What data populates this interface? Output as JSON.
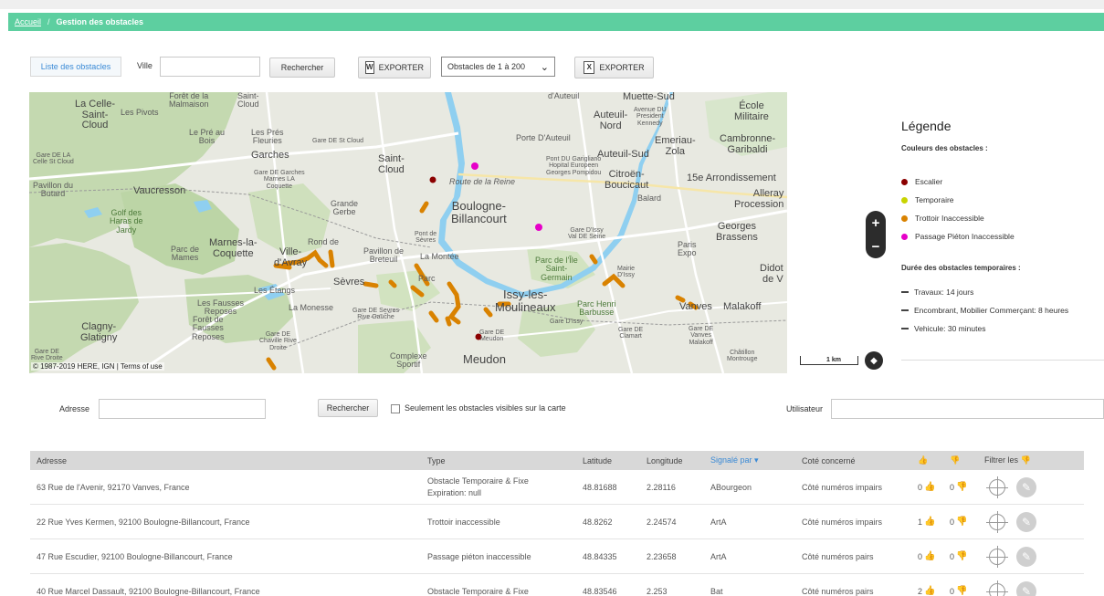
{
  "breadcrumb": {
    "home": "Accueil",
    "separator": "/",
    "current": "Gestion des obstacles"
  },
  "toolbar": {
    "list_tab": "Liste des obstacles",
    "ville_label": "Ville",
    "ville_value": "",
    "search_button": "Rechercher",
    "export_word": "EXPORTER",
    "export_excel": "EXPORTER",
    "range_select": "Obstacles de 1 à 200",
    "word_icon": "W",
    "excel_icon": "X"
  },
  "map": {
    "labels": {
      "la_celle": "La Celle-\nSaint-\nCloud",
      "pivots": "Les Pivots",
      "foret_malmaison": "Forêt de la\nMalmaison",
      "saint_cloud_small": "Saint-\nCloud",
      "pre_au_bois": "Le Pré au\nBois",
      "pres_fleuries": "Les Prés\nFleuries",
      "garches": "Garches",
      "gare_lacelle": "Gare DE LA\nCelle St Cloud",
      "gare_st_cloud": "Gare DE St Cloud",
      "saint_cloud": "Saint-\nCloud",
      "gare_garches": "Gare DE Garches\nMarnes LA\nCoquette",
      "pavillon_butard": "Pavillon du\nButard",
      "vaucresson": "Vaucresson",
      "grande_gerbe": "Grande\nGerbe",
      "golf": "Golf des\nHaras de\nJardy",
      "marnes": "Marnes-la-\nCoquette",
      "parc_mames": "Parc de\nMames",
      "ville_avray": "Ville-\nd'Avray",
      "rond": "Rond de",
      "pavillon_breteuil": "Pavillon de\nBreteuil",
      "sevres": "Sèvres",
      "etangs": "Les Étangs",
      "fausses_reposes": "Les Fausses\nReposes",
      "monesse": "La Monesse",
      "foret_fausses": "Forêt de\nFausses\nReposes",
      "clagny": "Clagny-\nGlatigny",
      "gare_chaville": "Gare DE\nChaville Rive\nDroite",
      "gare_sevres_rg": "Gare DE Sevres\nRive Gauche",
      "gare_rive": "Gare DE\nRive Droite",
      "complexe": "Complexe\nSportif",
      "meudon": "Meudon",
      "gare_meudon": "Gare DE\nMeudon",
      "auteuil_top": "d'Auteuil",
      "auteuil_nord": "Auteuil-\nNord",
      "porte_auteuil": "Porte D'Auteuil",
      "auteuil_sud": "Auteuil-Sud",
      "route_reine": "Route de la Reine",
      "boulogne": "Boulogne-\nBillancourt",
      "pont_sevres": "Pont de\nSèvres",
      "la_montee": "La Montée",
      "parc_sevres": "Parc",
      "pont_garigliano": "Pont DU Garigliano\nHopital Europeen\nGeorges Pompidou",
      "muette_sud": "Muette-Sud",
      "president_kennedy": "Avenue DU\nPresident\nKennedy",
      "emeriau": "Emeriau-\nZola",
      "citroen": "Citroën-\nBoucicaut",
      "balard": "Balard",
      "gare_issy": "Gare D'Issy\nVal DE Seine",
      "parc_ile": "Parc de l'Île\nSaint-\nGermain",
      "mairie_issy": "Mairie\nD'Issy",
      "issy": "Issy-les-\nMoulineaux",
      "parc_henri": "Parc Henri\nBarbusse",
      "gare_dissy": "Gare D'Issy",
      "gare_clamart": "Gare DE\nClamart",
      "ecole_militaire": "École\nMilitaire",
      "cambronne": "Cambronne-\nGaribaldi",
      "arrondissement": "15e Arrondissement",
      "alleray": "Alleray\nProcession",
      "brassens": "Georges\nBrassens",
      "paris_expo": "Paris\nExpo",
      "didot": "Didot\nde V",
      "vanves": "Vanves",
      "malakoff": "Malakoff",
      "gare_vanves": "Gare DE\nVanves\nMalakoff",
      "chatillon": "Châtillon\nMontrouge"
    },
    "copyright": "© 1987-2019 HERE, IGN | Terms of use",
    "zoom_in": "+",
    "zoom_out": "−",
    "scale": "1 km",
    "layers_icon": "◆"
  },
  "legend": {
    "title": "Légende",
    "colors_heading": "Couleurs des obstacles :",
    "colors": [
      {
        "label": "Escalier",
        "color": "#8b0000"
      },
      {
        "label": "Temporaire",
        "color": "#c8d400"
      },
      {
        "label": "Trottoir Inaccessible",
        "color": "#d98200"
      },
      {
        "label": "Passage Piéton Inaccessible",
        "color": "#e600c8"
      }
    ],
    "duration_heading": "Durée des obstacles temporaires :",
    "durations": [
      "Travaux: 14 jours",
      "Encombrant, Mobilier Commerçant: 8 heures",
      "Vehicule: 30 minutes"
    ]
  },
  "filters": {
    "adresse_label": "Adresse",
    "adresse_value": "",
    "search_button": "Rechercher",
    "visible_only": "Seulement les obstacles visibles sur la carte",
    "utilisateur_label": "Utilisateur",
    "utilisateur_value": ""
  },
  "table": {
    "headers": {
      "adresse": "Adresse",
      "type": "Type",
      "latitude": "Latitude",
      "longitude": "Longitude",
      "signale": "Signalé par ▾",
      "cote": "Coté concerné",
      "up": "👍",
      "down": "👎",
      "filtrer": "Filtrer les 👎"
    },
    "rows": [
      {
        "adresse": "63 Rue de l'Avenir, 92170 Vanves, France",
        "type": "Obstacle Temporaire & Fixe",
        "type2": "Expiration: null",
        "lat": "48.81688",
        "lon": "2.28116",
        "signale": "ABourgeon",
        "cote": "Côté numéros impairs",
        "up": "0",
        "down": "0"
      },
      {
        "adresse": "22 Rue Yves Kermen, 92100 Boulogne-Billancourt, France",
        "type": "Trottoir inaccessible",
        "type2": "",
        "lat": "48.8262",
        "lon": "2.24574",
        "signale": "ArtA",
        "cote": "Côté numéros impairs",
        "up": "1",
        "down": "0"
      },
      {
        "adresse": "47 Rue Escudier, 92100 Boulogne-Billancourt, France",
        "type": "Passage piéton inaccessible",
        "type2": "",
        "lat": "48.84335",
        "lon": "2.23658",
        "signale": "ArtA",
        "cote": "Côté numéros pairs",
        "up": "0",
        "down": "0"
      },
      {
        "adresse": "40 Rue Marcel Dassault, 92100 Boulogne-Billancourt, France",
        "type": "Obstacle Temporaire & Fixe",
        "type2": "",
        "lat": "48.83546",
        "lon": "2.253",
        "signale": "Bat",
        "cote": "Côté numéros pairs",
        "up": "2",
        "down": "0"
      }
    ],
    "thumb_up": "👍",
    "thumb_down": "👎",
    "pencil_icon": "✎"
  }
}
